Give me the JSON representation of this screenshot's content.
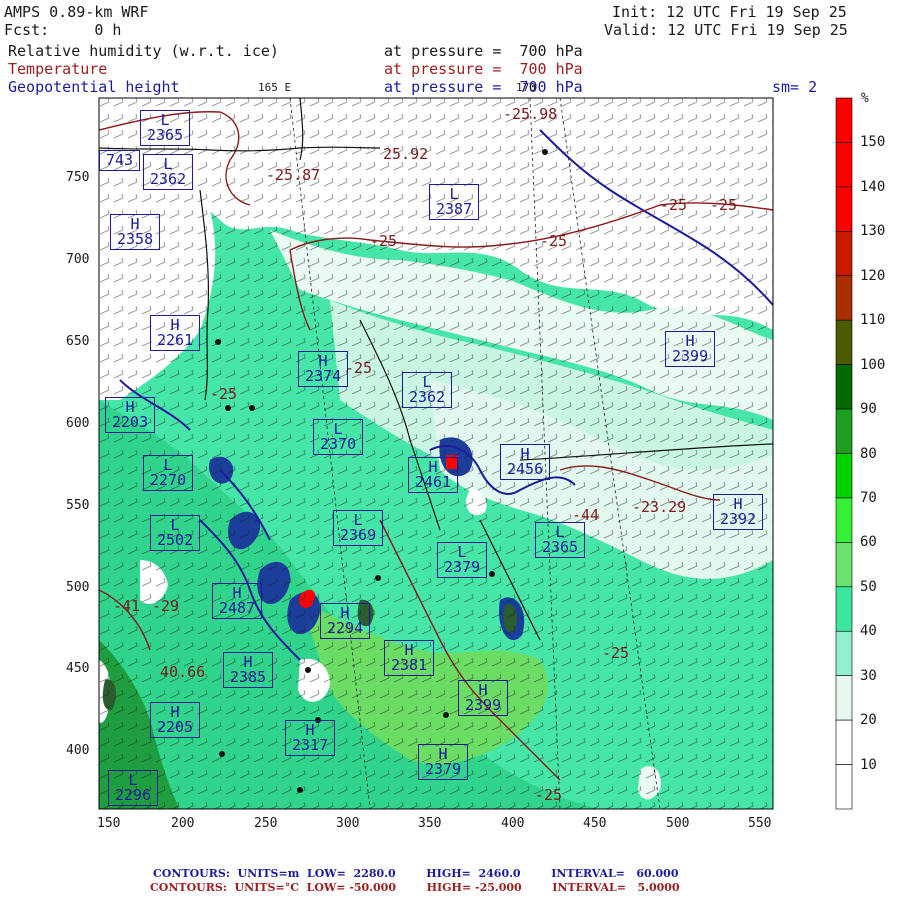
{
  "header": {
    "model": "AMPS 0.89-km WRF",
    "fcst_label": "Fcst:",
    "fcst_value": "0 h",
    "init": "Init: 12 UTC Fri 19 Sep 25",
    "valid": "Valid: 12 UTC Fri 19 Sep 25",
    "field1": "Relative humidity (w.r.t. ice)",
    "field2": "Temperature",
    "field3": "Geopotential height",
    "pressure": "at pressure =  700 hPa",
    "lon_label": "165 E",
    "lon_label2": "170",
    "smoothing": "sm= 2"
  },
  "colorbar": {
    "unit": "%",
    "ticks": [
      "150",
      "140",
      "130",
      "120",
      "110",
      "100",
      "90",
      "80",
      "70",
      "60",
      "50",
      "40",
      "30",
      "20",
      "10"
    ],
    "colors": [
      "#ff0000",
      "#ff0000",
      "#ff0000",
      "#cc1a00",
      "#a83000",
      "#4d5a00",
      "#006b00",
      "#1e9e1e",
      "#00d200",
      "#35f035",
      "#6ce06c",
      "#3ce8a0",
      "#90f0d0",
      "#e8f8f0",
      "#ffffff",
      "#ffffff"
    ]
  },
  "axes": {
    "x_ticks": [
      "150",
      "200",
      "250",
      "300",
      "350",
      "400",
      "450",
      "500",
      "550"
    ],
    "y_ticks": [
      "750",
      "700",
      "650",
      "600",
      "550",
      "500",
      "450",
      "400"
    ]
  },
  "labels": {
    "height_boxes": [
      {
        "t": "L",
        "v": "2365"
      },
      {
        "t": "L",
        "v": "2362"
      },
      {
        "t": "",
        "v": "743"
      },
      {
        "t": "H",
        "v": "2358"
      },
      {
        "t": "L",
        "v": "2387"
      },
      {
        "t": "H",
        "v": "2399"
      },
      {
        "t": "H",
        "v": "2261"
      },
      {
        "t": "H",
        "v": "2374"
      },
      {
        "t": "L",
        "v": "2362"
      },
      {
        "t": "L",
        "v": "2370"
      },
      {
        "t": "H",
        "v": "2461"
      },
      {
        "t": "H",
        "v": "2456"
      },
      {
        "t": "H",
        "v": "2392"
      },
      {
        "t": "L",
        "v": "2369"
      },
      {
        "t": "L",
        "v": "2365"
      },
      {
        "t": "L",
        "v": "2379"
      },
      {
        "t": "L",
        "v": "2270"
      },
      {
        "t": "L",
        "v": "2502"
      },
      {
        "t": "H",
        "v": "2487"
      },
      {
        "t": "H",
        "v": "2294"
      },
      {
        "t": "H",
        "v": "2381"
      },
      {
        "t": "H",
        "v": "2399"
      },
      {
        "t": "H",
        "v": "2385"
      },
      {
        "t": "H",
        "v": "2205"
      },
      {
        "t": "H",
        "v": "2317"
      },
      {
        "t": "H",
        "v": "2379"
      },
      {
        "t": "H",
        "v": "2203"
      },
      {
        "t": "L",
        "v": "2296"
      }
    ],
    "temp_values": [
      "-25.98",
      "25.92",
      "-25.87",
      "-25",
      "-25",
      "-25",
      "-25",
      "-23.29",
      "-44",
      "-25",
      "-25",
      "-41",
      "-29",
      "40.66",
      "-25",
      "-25"
    ]
  },
  "footer": {
    "line1": "CONTOURS:  UNITS=m  LOW=  2280.0        HIGH=  2460.0        INTERVAL=   60.000",
    "line2": "CONTOURS:  UNITS=°C  LOW= -50.000        HIGH= -25.000        INTERVAL=   5.0000"
  }
}
